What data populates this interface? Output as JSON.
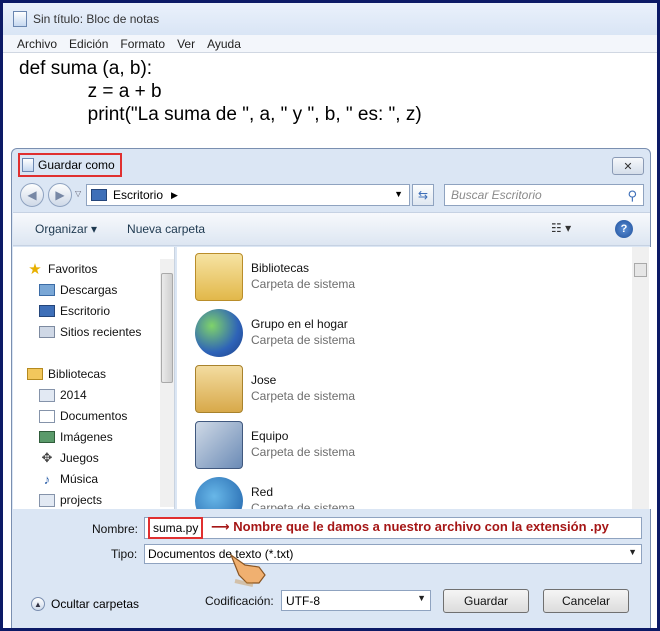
{
  "notepad": {
    "title": "Sin título: Bloc de notas",
    "menu": [
      "Archivo",
      "Edición",
      "Formato",
      "Ver",
      "Ayuda"
    ],
    "code_lines": [
      "def suma (a, b):",
      "             z = a + b",
      "             print(\"La suma de \", a, \" y \", b, \" es: \", z)"
    ]
  },
  "dialog": {
    "title": "Guardar como",
    "address": "Escritorio",
    "search_placeholder": "Buscar Escritorio",
    "toolbar": {
      "organize": "Organizar ▾",
      "new_folder": "Nueva carpeta"
    },
    "nav": {
      "favorites_header": "Favoritos",
      "favorites": [
        "Descargas",
        "Escritorio",
        "Sitios recientes"
      ],
      "libraries_header": "Bibliotecas",
      "libraries": [
        "2014",
        "Documentos",
        "Imágenes",
        "Juegos",
        "Música",
        "projects"
      ]
    },
    "items": [
      {
        "name": "Bibliotecas",
        "type": "Carpeta de sistema"
      },
      {
        "name": "Grupo en el hogar",
        "type": "Carpeta de sistema"
      },
      {
        "name": "Jose",
        "type": "Carpeta de sistema"
      },
      {
        "name": "Equipo",
        "type": "Carpeta de sistema"
      },
      {
        "name": "Red",
        "type": "Carpeta de sistema"
      }
    ],
    "filename_label": "Nombre:",
    "filename_value": "suma.py",
    "type_label": "Tipo:",
    "type_value": "Documentos de texto (*.txt)",
    "annotation": "Nombre que le damos a nuestro archivo con la extensión .py",
    "hide_folders": "Ocultar carpetas",
    "encoding_label": "Codificación:",
    "encoding_value": "UTF-8",
    "save_button": "Guardar",
    "cancel_button": "Cancelar"
  },
  "colors": {
    "highlight_red": "#e03030",
    "annotation_text": "#a51616",
    "dialog_bg": "#dbe6f4"
  }
}
